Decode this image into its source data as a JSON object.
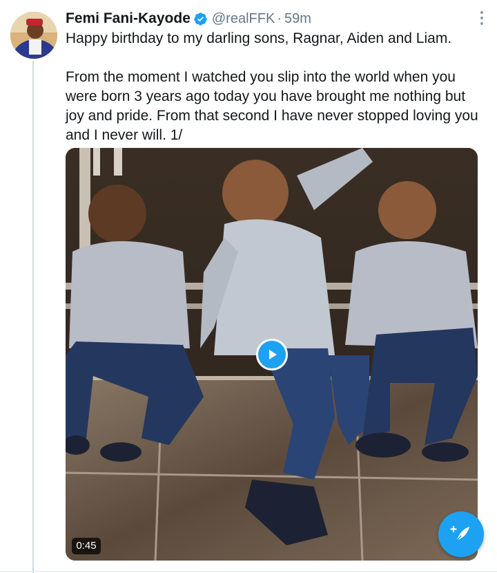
{
  "tweet": {
    "author_name": "Femi Fani-Kayode",
    "handle": "@realFFK",
    "separator": "·",
    "timestamp": "59m",
    "text": "Happy birthday to my darling sons, Ragnar, Aiden and Liam.\n\nFrom the moment I watched you slip into the world when you were born 3 years ago today you have brought me nothing but joy and pride. From that second I have never stopped loving you and I never will. 1/"
  },
  "media": {
    "type": "video",
    "duration": "0:45"
  },
  "colors": {
    "accent": "#1da1f2",
    "text": "#14171a",
    "secondary_text": "#657786",
    "thread_line": "#cfd9de"
  },
  "icons": {
    "verified": "verified-badge-icon",
    "more": "more-options-icon",
    "play": "play-icon",
    "compose": "compose-tweet-icon"
  }
}
